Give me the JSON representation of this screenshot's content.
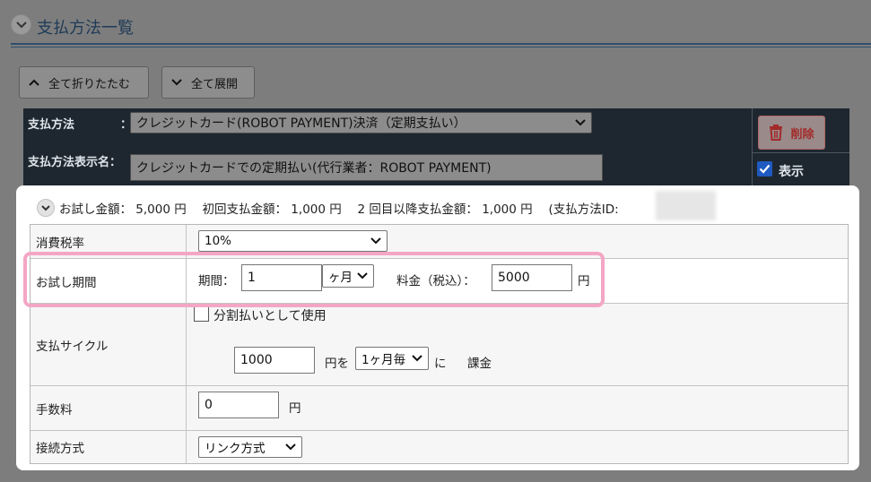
{
  "header": {
    "title": "支払方法一覧",
    "collapse_all_label": "全て折りたたむ",
    "expand_all_label": "全て展開"
  },
  "method_panel": {
    "payment_method_label": "支払方法",
    "colon": "：",
    "payment_method_value": "クレジットカード(ROBOT PAYMENT)決済（定期支払い）",
    "display_name_label": "支払方法表示名：",
    "display_name_value": "クレジットカードでの定期払い(代行業者：ROBOT PAYMENT)",
    "delete_label": "削除",
    "show_label": "表示",
    "show_checked": true
  },
  "summary": {
    "text": "お試し金額： 5,000 円　 初回支払金額： 1,000 円　 2 回目以降支払金額： 1,000 円　 (支払方法ID:"
  },
  "rows": {
    "tax": {
      "label": "消費税率",
      "value": "10%"
    },
    "trial": {
      "label": "お試し期間",
      "period_label": "期間：",
      "period_value": "1",
      "period_unit": "ヶ月",
      "fee_label": "料金（税込）：",
      "fee_value": "5000",
      "yen": "円"
    },
    "cycle": {
      "label": "支払サイクル",
      "installment_label": "分割払いとして使用",
      "amount_value": "1000",
      "yen_wo": "円を",
      "cycle_value": "1ヶ月毎",
      "ni": "に",
      "charge": "課金"
    },
    "fee": {
      "label": "手数料",
      "value": "0",
      "yen": "円"
    },
    "connection": {
      "label": "接続方式",
      "value": "リンク方式"
    }
  },
  "colors": {
    "header_navy": "#1f3b57",
    "panel_dark": "#1e2730",
    "highlight_pink": "#f4a6c5",
    "delete_red": "#a32a2a",
    "checkbox_blue": "#1e5ac0"
  }
}
